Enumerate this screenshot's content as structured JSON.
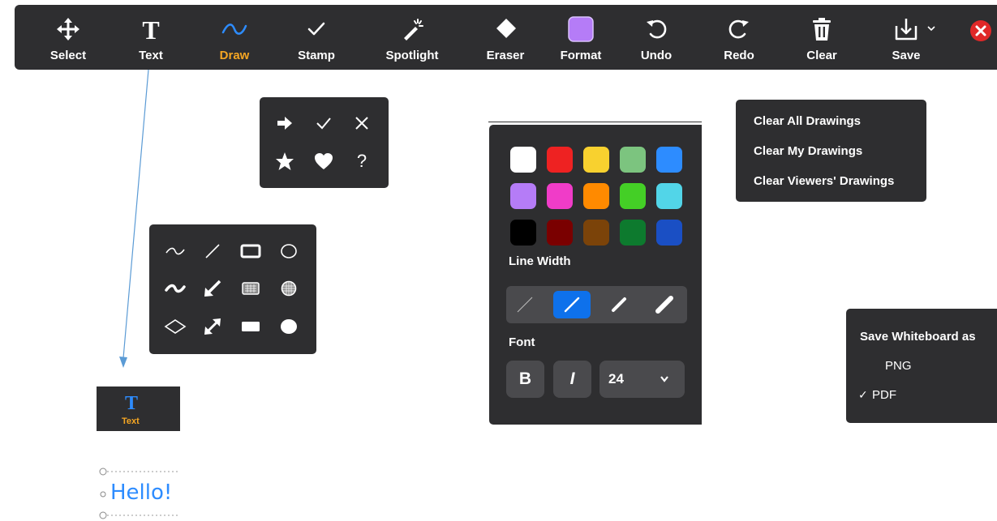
{
  "toolbar": {
    "tools": [
      {
        "label": "Select",
        "icon": "move-icon"
      },
      {
        "label": "Text",
        "icon": "text-icon"
      },
      {
        "label": "Draw",
        "icon": "squiggle-icon",
        "active": true
      },
      {
        "label": "Stamp",
        "icon": "check-icon"
      },
      {
        "label": "Spotlight",
        "icon": "magic-wand-icon"
      },
      {
        "label": "Eraser",
        "icon": "eraser-icon"
      },
      {
        "label": "Format",
        "icon": "format-color-icon"
      },
      {
        "label": "Undo",
        "icon": "undo-icon"
      },
      {
        "label": "Redo",
        "icon": "redo-icon"
      },
      {
        "label": "Clear",
        "icon": "trash-icon"
      },
      {
        "label": "Save",
        "icon": "save-icon"
      }
    ],
    "active_color": "#f5a623",
    "format_color": "#b57cf7",
    "close_color": "#e02828"
  },
  "stamp_menu": {
    "icons": [
      "arrow-right-icon",
      "check-icon",
      "x-icon",
      "star-icon",
      "heart-icon",
      "question-icon"
    ],
    "question_glyph": "?"
  },
  "draw_menu": {
    "icons": [
      "line-squiggle-icon",
      "line-straight-icon",
      "rectangle-outline-icon",
      "ellipse-outline-icon",
      "thick-squiggle-icon",
      "arrow-icon",
      "rectangle-fill-semi-icon",
      "ellipse-fill-semi-icon",
      "diamond-icon",
      "double-arrow-icon",
      "rectangle-fill-icon",
      "ellipse-fill-icon"
    ]
  },
  "format_menu": {
    "colors": [
      "#ffffff",
      "#ee2222",
      "#f8d12f",
      "#7cc47f",
      "#2d8cff",
      "#b57cf7",
      "#f03cc8",
      "#ff8a00",
      "#44cf26",
      "#52d5e8",
      "#000000",
      "#7a0000",
      "#7b4309",
      "#0d7a2e",
      "#1a4fc4"
    ],
    "line_width_label": "Line Width",
    "font_label": "Font",
    "bold_label": "B",
    "italic_label": "I",
    "font_size": "24",
    "selected_line_width": 2
  },
  "clear_menu": {
    "items": [
      "Clear All Drawings",
      "Clear My Drawings",
      "Clear Viewers' Drawings"
    ]
  },
  "save_menu": {
    "title": "Save Whiteboard as",
    "options": [
      "PNG",
      "PDF"
    ],
    "selected": "PDF",
    "check_glyph": "✓"
  },
  "text_preview": {
    "label": "Text",
    "sample_text": "Hello!"
  }
}
